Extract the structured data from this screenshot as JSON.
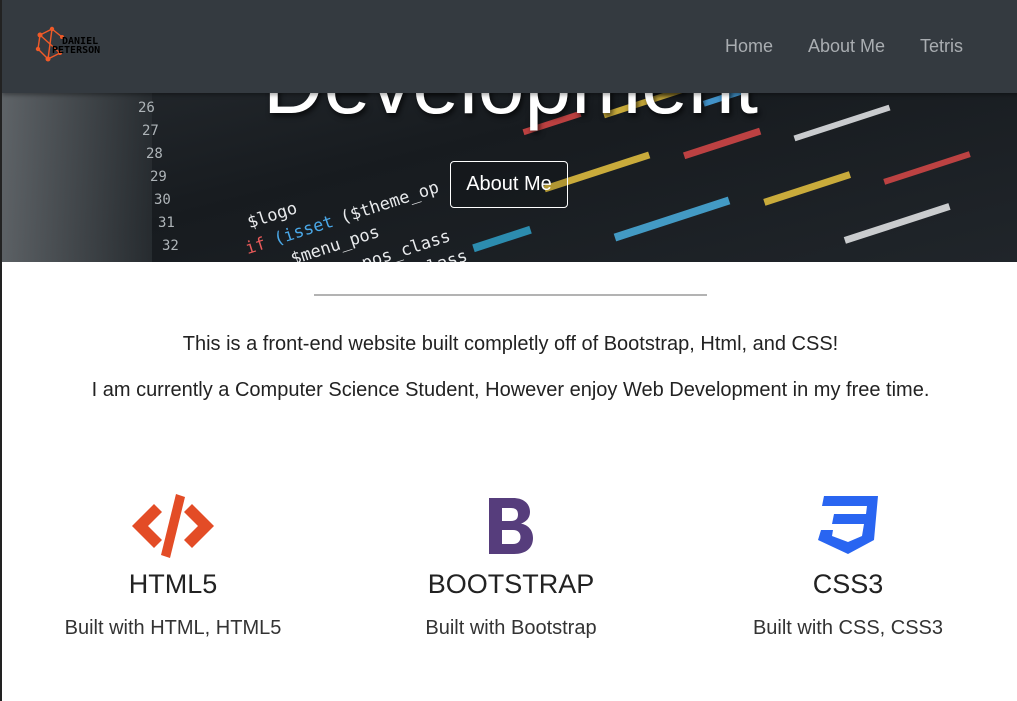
{
  "hero": {
    "title": "Development",
    "button_label": "About Me"
  },
  "navbar": {
    "brand": {
      "line1": "DANIEL",
      "line2": "PETERSON",
      "logo_icon": "network-nodes-icon",
      "accent_color": "#f05a28"
    },
    "links": [
      {
        "label": "Home"
      },
      {
        "label": "About Me"
      },
      {
        "label": "Tetris"
      }
    ],
    "background_color": "#343a40",
    "link_color": "#a9adb1"
  },
  "intro": {
    "line1": "This is a front-end website built completly off of Bootstrap, Html, and CSS!",
    "line2": "I am currently a Computer Science Student, However enjoy Web Development in my free time."
  },
  "features": [
    {
      "icon": "code-brackets-icon",
      "name": "HTML5",
      "description": "Built with HTML, HTML5",
      "color": "#e34c26"
    },
    {
      "icon": "bootstrap-b-icon",
      "name": "BOOTSTRAP",
      "description": "Built with Bootstrap",
      "color": "#563d7c"
    },
    {
      "icon": "css3-shield-icon",
      "name": "CSS3",
      "description": "Built with CSS, CSS3",
      "color": "#2965f1"
    }
  ]
}
